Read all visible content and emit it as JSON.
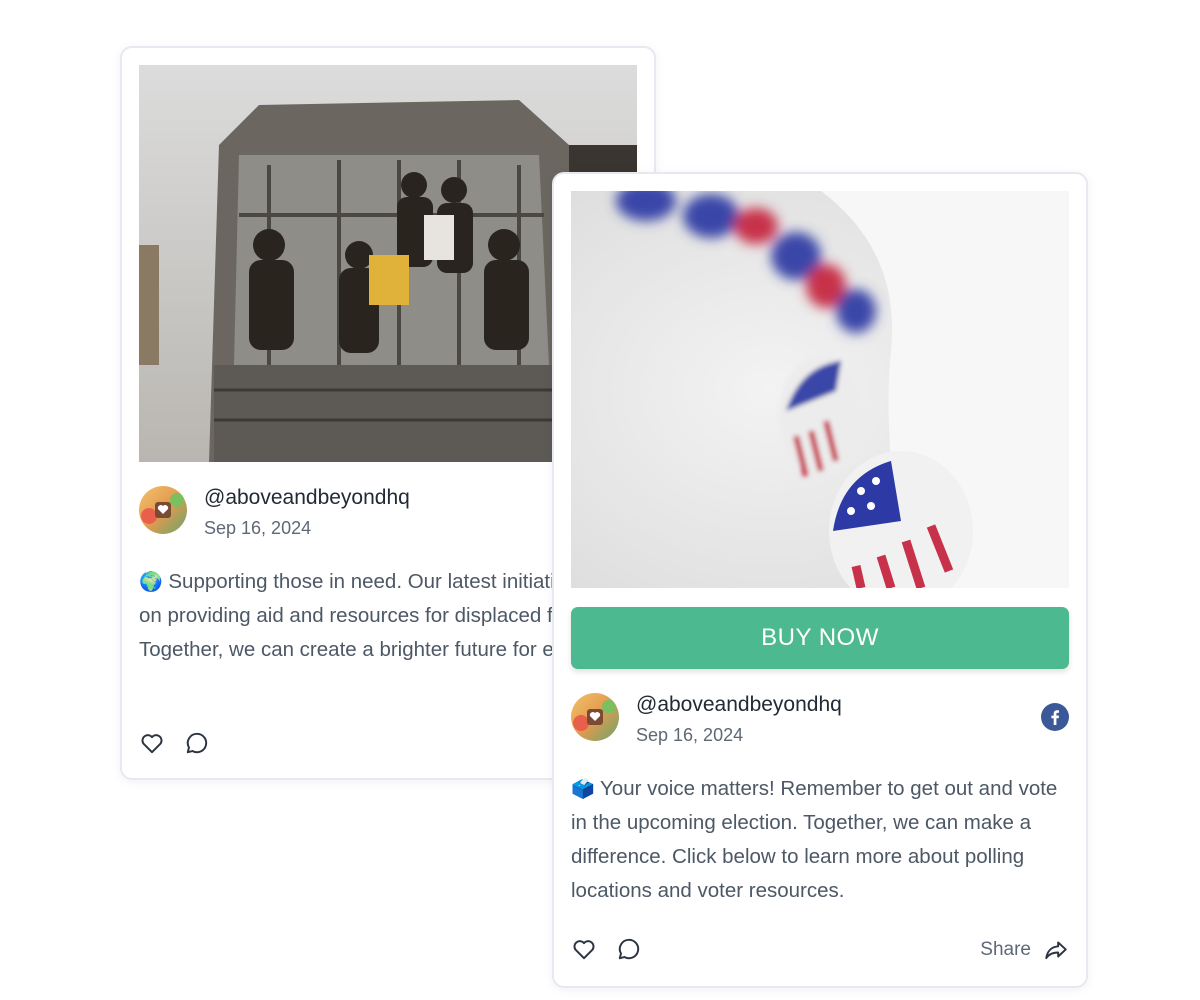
{
  "posts": [
    {
      "handle": "@aboveandbeyondhq",
      "date": "Sep 16, 2024",
      "emoji": "🌍",
      "text": " Supporting those in need. Our latest initiative focuses on providing aid and resources for displaced families. Together, we can create a brighter future for everyone.",
      "icons": [
        "heart-icon",
        "comment-icon"
      ]
    },
    {
      "cta_label": "BUY NOW",
      "handle": "@aboveandbeyondhq",
      "date": "Sep 16, 2024",
      "emoji": "🗳️",
      "text": " Your voice matters! Remember to get out and vote in the upcoming election. Together, we can make a difference. Click below to learn more about polling locations and voter resources.",
      "share_label": "Share",
      "icons": [
        "heart-icon",
        "comment-icon",
        "share-arrow-icon",
        "facebook-icon"
      ]
    }
  ],
  "colors": {
    "cta": "#4cb990",
    "facebook": "#3b5998",
    "text_body": "#4d5866",
    "card_border": "#e6e9ef"
  }
}
